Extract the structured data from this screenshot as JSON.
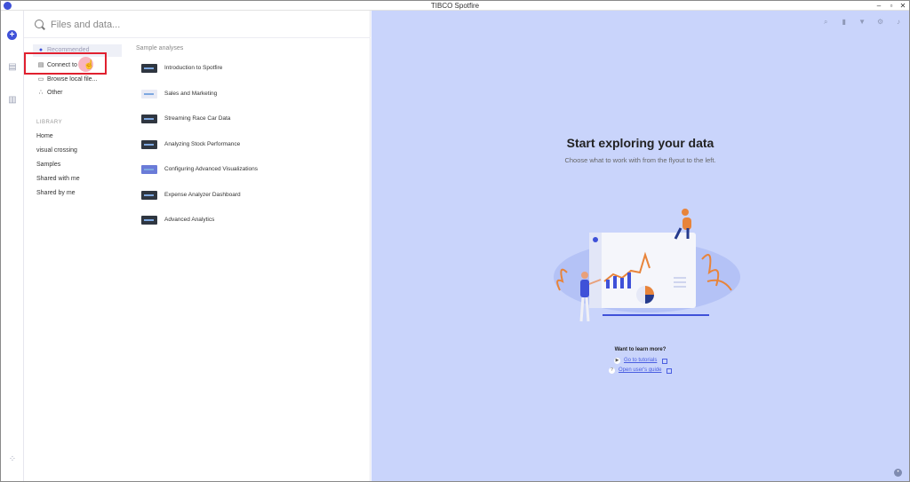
{
  "window": {
    "title": "TIBCO Spotfire",
    "controls": [
      "–",
      "▫",
      "✕"
    ]
  },
  "rail": {
    "icons": [
      "add-icon",
      "data-icon",
      "chart-icon",
      "network-icon"
    ]
  },
  "flyout": {
    "search": {
      "placeholder": "Files and data..."
    },
    "nav": [
      {
        "label": "Recommended",
        "icon": "pin-icon"
      },
      {
        "label": "Connect to",
        "icon": "database-icon"
      },
      {
        "label": "Browse local file...",
        "icon": "folder-icon"
      },
      {
        "label": "Other",
        "icon": "dots-icon"
      }
    ],
    "library": {
      "heading": "LIBRARY",
      "items": [
        "Home",
        "visual crossing",
        "Samples",
        "Shared with me",
        "Shared by me"
      ]
    },
    "samples": {
      "heading": "Sample analyses",
      "items": [
        "Introduction to Spotfire",
        "Sales and Marketing",
        "Streaming Race Car Data",
        "Analyzing Stock Performance",
        "Configuring Advanced Visualizations",
        "Expense Analyzer Dashboard",
        "Advanced Analytics"
      ]
    }
  },
  "main": {
    "headline": "Start exploring your data",
    "subline": "Choose what to work with from the flyout to the left.",
    "learn": {
      "heading": "Want to learn more?",
      "tutorials": "Go to tutorials",
      "guide": "Open user's guide"
    },
    "toolbar_icons": [
      "search-icon",
      "bookmark-icon",
      "filter-icon",
      "settings-icon",
      "bell-icon"
    ]
  },
  "colors": {
    "accent": "#3f51d8",
    "main_bg": "#c9d4fb",
    "highlight": "#e0202f"
  }
}
